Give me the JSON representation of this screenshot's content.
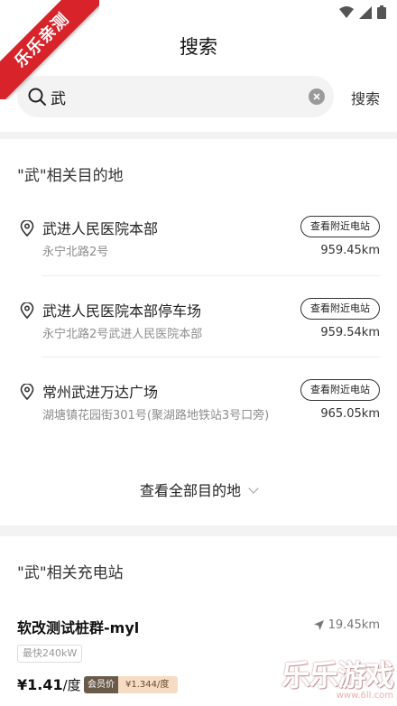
{
  "corner_badge": "乐乐亲测",
  "header": {
    "title": "搜索"
  },
  "search": {
    "query": "武",
    "button_label": "搜索"
  },
  "destinations": {
    "section_title": "\"武\"相关目的地",
    "nearby_label": "查看附近电站",
    "items": [
      {
        "name": "武进人民医院本部",
        "address": "永宁北路2号",
        "distance": "959.45km"
      },
      {
        "name": "武进人民医院本部停车场",
        "address": "永宁北路2号武进人民医院本部",
        "distance": "959.54km"
      },
      {
        "name": "常州武进万达广场",
        "address": "湖塘镇花园街301号(聚湖路地铁站3号口旁)",
        "distance": "965.05km"
      }
    ],
    "view_all_label": "查看全部目的地"
  },
  "stations": {
    "section_title": "\"武\"相关充电站",
    "items": [
      {
        "name": "软改测试桩群-myl",
        "distance": "19.45km",
        "speed_tag": "最快240kW",
        "price": "¥1.41",
        "price_unit": "/度",
        "member_label": "会员价",
        "member_price": "¥1.344/度"
      }
    ]
  },
  "watermark": {
    "main": "乐乐游戏",
    "sub": "www.6ll.com"
  },
  "colors": {
    "badge": "#d8232a",
    "background": "#f3f3f3",
    "member_tag": "#f6dcc4"
  }
}
